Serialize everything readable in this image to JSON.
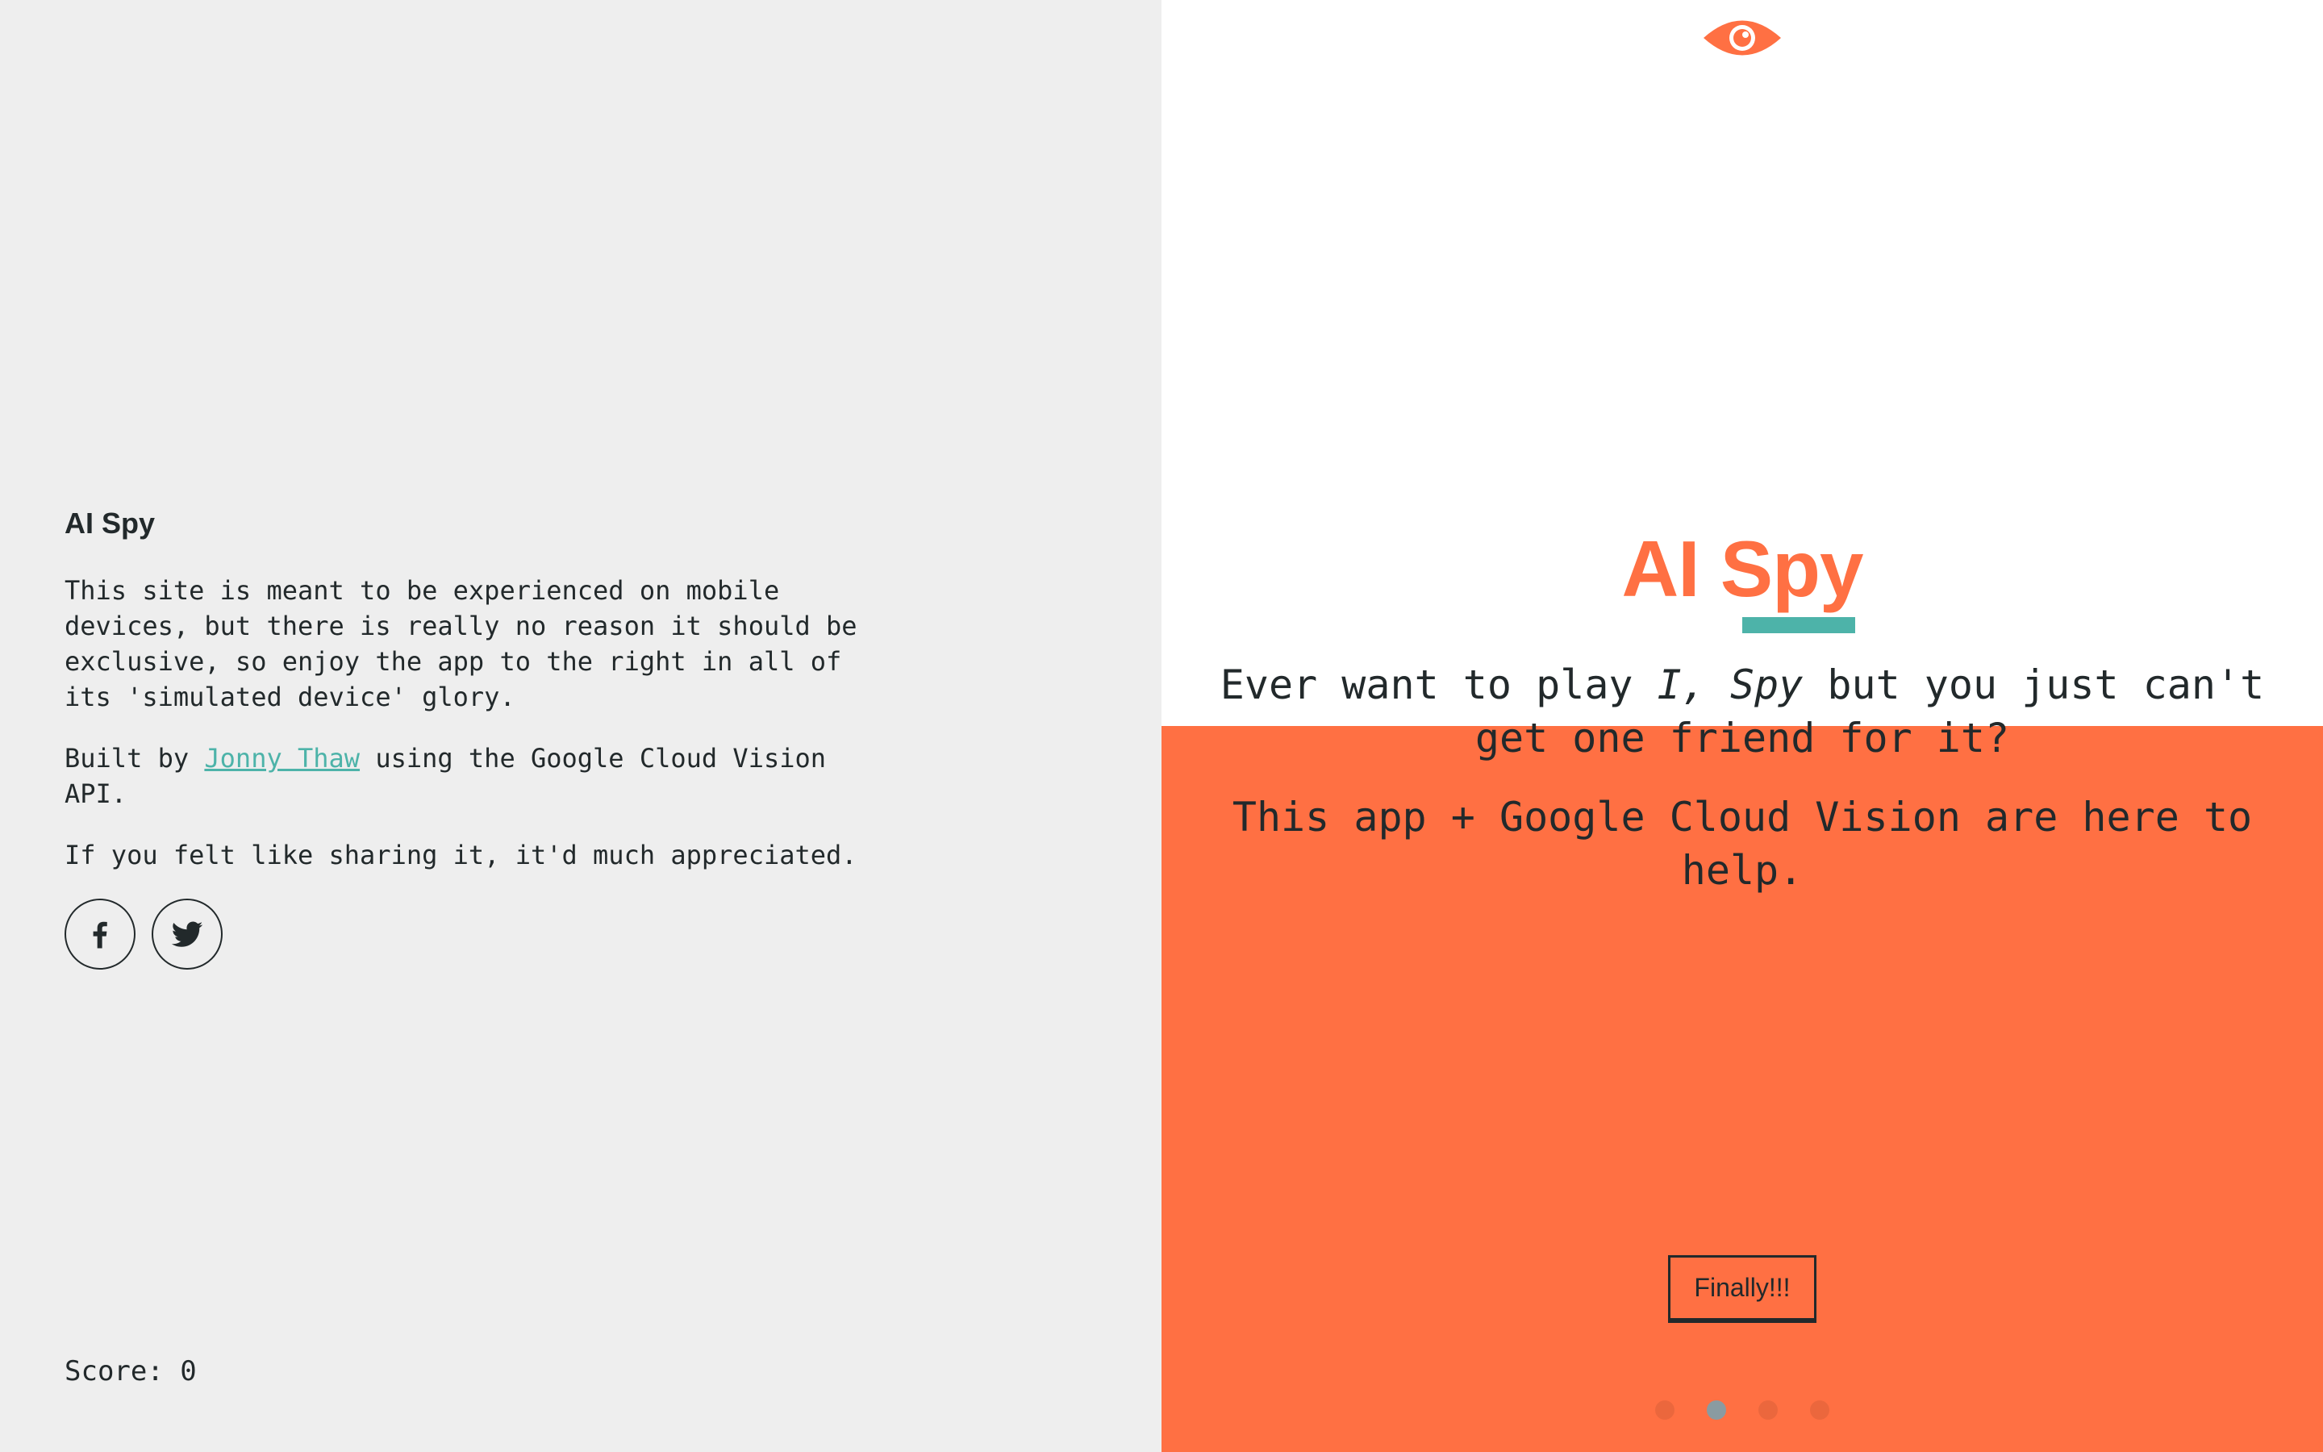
{
  "info": {
    "app_name": "AI Spy",
    "paragraph1": "This site is meant to be experienced on mobile devices, but there is really no reason it should be exclusive, so enjoy the app to the right in all of its 'simulated device' glory.",
    "built_by_prefix": "Built by ",
    "author_name": "Jonny Thaw",
    "built_by_suffix": " using the Google Cloud Vision API.",
    "share_text": "If you felt like sharing it, it'd much appreciated.",
    "social": [
      {
        "name": "facebook",
        "icon": "facebook-icon"
      },
      {
        "name": "twitter",
        "icon": "twitter-icon"
      }
    ],
    "score_text": "Score: 0"
  },
  "device": {
    "top_icon": "eye-icon",
    "logo": "AI Spy",
    "tagline1_a": "Ever want to play ",
    "tagline1_em": "I, Spy",
    "tagline1_b": " but you just can't get one friend for it?",
    "tagline2": "This app + Google Cloud Vision are here to help.",
    "button_label": "Finally!!!",
    "pagination": {
      "total": 4,
      "active_index": 1
    }
  },
  "colors": {
    "accent_orange": "#ff7043",
    "accent_teal": "#4db3a9",
    "text_dark": "#22292b",
    "left_background": "#eeeeee",
    "dot_active": "#8a9ba1"
  }
}
